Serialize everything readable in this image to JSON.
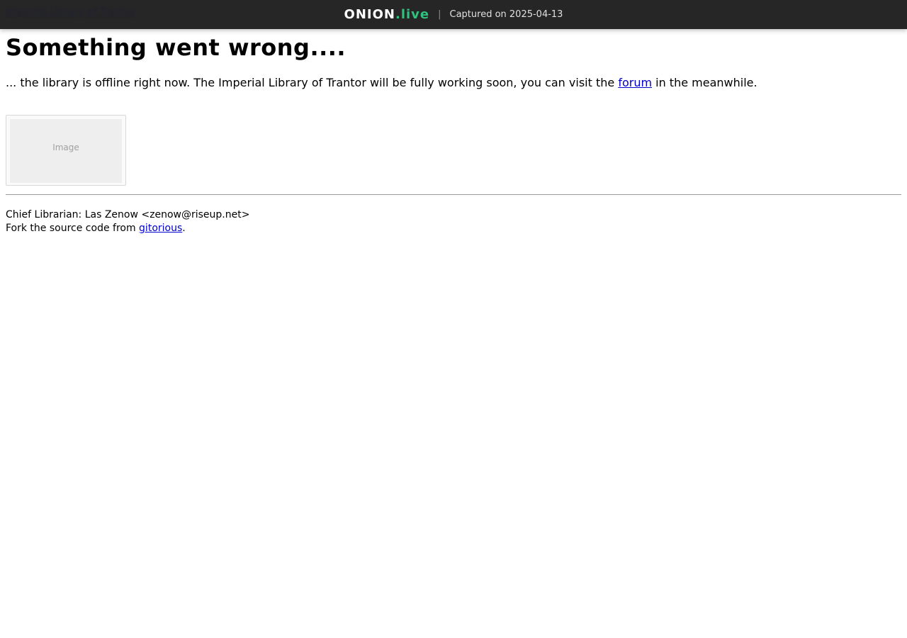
{
  "topbar": {
    "hidden_link": "Imperial Library of Trantor",
    "brand_main": "ONION",
    "brand_accent": ".live",
    "separator": "|",
    "captured": "Captured on 2025-04-13",
    "accent_color": "#2ec27e"
  },
  "main": {
    "title": "Something went wrong....",
    "intro_before": "... the library is offline right now. The Imperial Library of Trantor will be fully working soon, you can visit the ",
    "intro_link": "forum",
    "intro_after": " in the meanwhile.",
    "image_placeholder": "Image"
  },
  "footer": {
    "librarian": "Chief Librarian: Las Zenow <zenow@riseup.net>",
    "fork_before": "Fork the source code from ",
    "fork_link": "gitorious",
    "fork_after": "."
  }
}
